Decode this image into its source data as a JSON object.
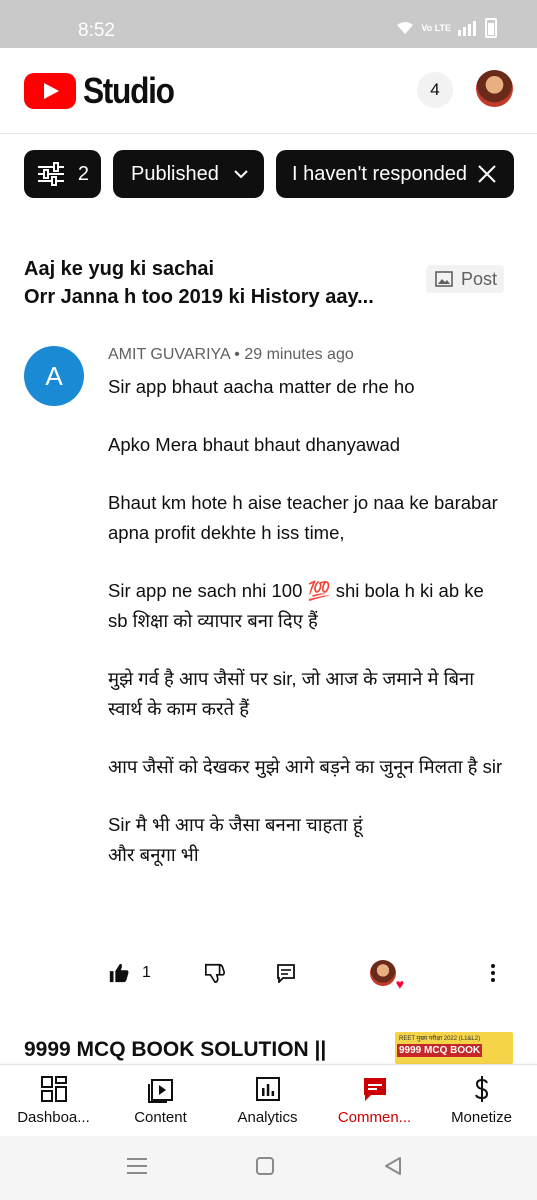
{
  "status_bar": {
    "time": "8:52",
    "volte_label": "Vo LTE"
  },
  "app": {
    "brand": "Studio",
    "notification_count": "4"
  },
  "filters": {
    "filter_count": "2",
    "published_label": "Published",
    "response_label": "I haven't responded"
  },
  "post": {
    "title_line1": "Aaj ke yug ki sachai",
    "title_line2": "Orr Janna h too 2019 ki History aay...",
    "type_label": "Post"
  },
  "comment": {
    "avatar_letter": "A",
    "author": "AMIT GUVARIYA",
    "separator": "•",
    "time": "29 minutes ago",
    "paragraphs": [
      "Sir app bhaut aacha matter de rhe ho",
      "Apko Mera bhaut bhaut dhanyawad",
      "Bhaut km hote h aise teacher jo naa ke barabar apna profit  dekhte h iss time,",
      "Sir app ne sach nhi 100 💯 shi bola h ki ab ke sb शिक्षा को व्यापार बना दिए हैं",
      "मुझे गर्व है आप जैसों पर sir, जो आज के जमाने मे बिना स्वार्थ के काम करते हैं",
      "आप जैसों को देखकर मुझे आगे बड़ने का जुनून मिलता है sir",
      "Sir मै भी आप के जैसा बनना चाहता हूं\nऔर बनूगा भी"
    ],
    "like_count": "1"
  },
  "next_post": {
    "title": "9999 MCQ BOOK SOLUTION ||",
    "thumb_caption": "REET मुख्य परीक्षा 2022 (L1&L2)",
    "thumb_title": "9999 MCQ BOOK"
  },
  "bottom_nav": [
    {
      "label": "Dashboa...",
      "icon": "dashboard-icon"
    },
    {
      "label": "Content",
      "icon": "content-icon"
    },
    {
      "label": "Analytics",
      "icon": "analytics-icon"
    },
    {
      "label": "Commen...",
      "icon": "comments-icon",
      "active": true
    },
    {
      "label": "Monetize",
      "icon": "monetize-icon"
    }
  ],
  "colors": {
    "brand_red": "#ff0000",
    "active_nav": "#cc0000",
    "avatar_blue": "#1a8ad4",
    "chip_bg": "#0f0f0f",
    "status_bar_bg": "#c9c9c9"
  }
}
